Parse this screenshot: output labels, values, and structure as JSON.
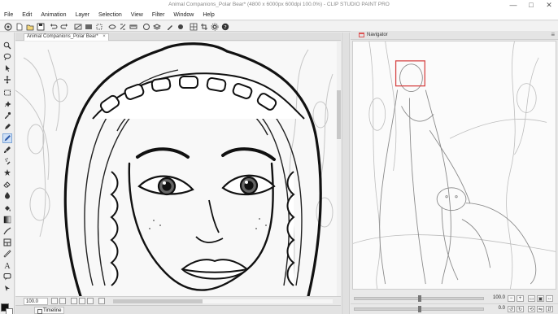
{
  "window": {
    "title": "Animal Companions_Polar Bear* (4800 x 6000px 600dpi 100.0%) - CLIP STUDIO PAINT PRO",
    "controls": {
      "minimize": "—",
      "maximize": "□",
      "close": "✕"
    }
  },
  "menu": [
    "File",
    "Edit",
    "Animation",
    "Layer",
    "Selection",
    "View",
    "Filter",
    "Window",
    "Help"
  ],
  "command_bar": {
    "icons": [
      "clip-studio-icon",
      "new-icon",
      "open-icon",
      "save-icon",
      "undo-icon",
      "redo-icon",
      "clear-icon",
      "fill-icon",
      "transform-icon",
      "hide-selection-icon",
      "snap-icon",
      "ruler-icon",
      "help-icon"
    ]
  },
  "tools": [
    "zoom-icon",
    "move-icon",
    "operation-icon",
    "move-layer-icon",
    "selection-icon",
    "auto-select-icon",
    "eyedropper-icon",
    "pen-icon",
    "pencil-icon",
    "brush-icon",
    "airbrush-icon",
    "decoration-icon",
    "eraser-icon",
    "blend-icon",
    "fill-icon",
    "gradient-icon",
    "figure-icon",
    "frame-icon",
    "ruler-icon",
    "text-icon",
    "balloon-icon",
    "correct-line-icon"
  ],
  "canvas": {
    "tab_label": "Animal Companions_Polar Bear*",
    "tab_close": "×",
    "zoom_value": "100.0"
  },
  "timeline": {
    "label": "Timeline"
  },
  "navigator": {
    "title": "Navigator",
    "menu_glyph": "≡",
    "zoom_value": "100.0",
    "rotation_value": "0.0"
  },
  "colors": {
    "main": "#111111",
    "sub": "#ffffff",
    "accent": "#d64545",
    "active_tool": "#cfe0f6"
  }
}
